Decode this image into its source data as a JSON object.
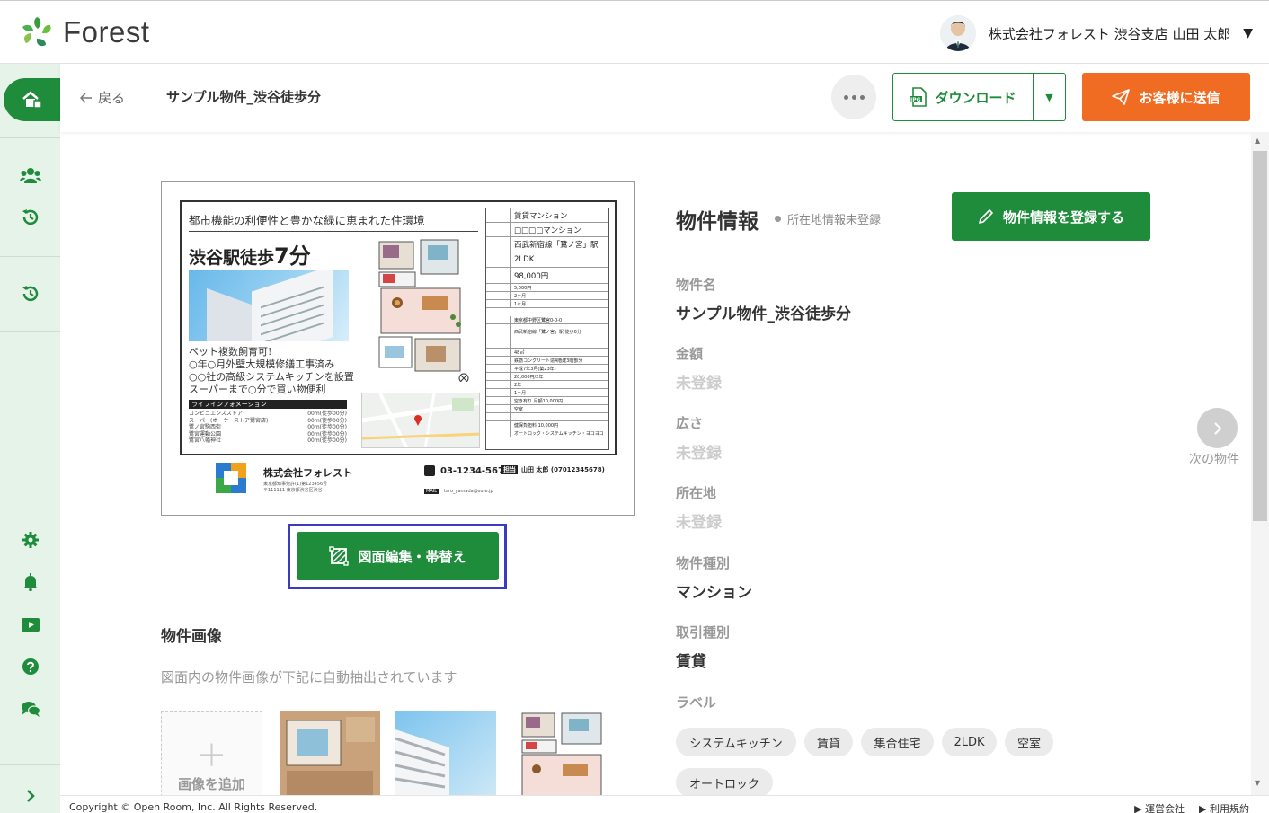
{
  "header": {
    "logo_text": "Forest",
    "user_name": "株式会社フォレスト 渋谷支店 山田 太郎",
    "user_menu_icon": "caret-down-icon"
  },
  "subbar": {
    "back_label": "戻る",
    "title": "サンプル物件_渋谷徒歩分",
    "download_label": "ダウンロード",
    "send_label": "お客様に送信"
  },
  "flyer": {
    "headline": "都市機能の利便性と豊かな緑に恵まれた住環境",
    "walk_prefix": "渋谷駅徒歩",
    "walk_minutes": "7分",
    "notes": [
      "ペット複数飼育可!",
      "○年○月外壁大規模修繕工事済み",
      "○○社の高級システムキッチンを設置",
      "スーパーまで○分で買い物便利"
    ],
    "info_heading": "ライフインフォメーション",
    "facilities": [
      {
        "name": "コンビニエンスストア",
        "dist": "00m(徒歩00分)"
      },
      {
        "name": "スーパー(オーケーストア鷺宮店)",
        "dist": "00m(徒歩00分)"
      },
      {
        "name": "鷺ノ宮駒西街",
        "dist": "00m(徒歩00分)"
      },
      {
        "name": "鷺宮運動公園",
        "dist": "00m(徒歩00分)"
      },
      {
        "name": "鷺宮八幡神社",
        "dist": "00m(徒歩00分)"
      }
    ],
    "table": [
      "賃貸マンション",
      "□□□□マンション",
      "西武新宿線「鷺ノ宮」駅",
      "2LDK",
      "98,000円",
      "5,000円",
      "2ヶ月",
      "1ヶ月"
    ],
    "table_small": [
      "東京都中野区鷺宮0-0-0",
      "西武新宿線「鷺ノ宮」駅 徒歩0分",
      "",
      "48㎡",
      "鉄筋コンクリート造4階建3階部分",
      "平成7年3月(築23年)",
      "20,000円/2年",
      "2年",
      "1ヶ月",
      "空き有り 月額10,000円",
      "空室",
      "",
      "健保負担料 10,000円",
      "オートロック・システムキッチン・ヨコヨコ"
    ],
    "company": "株式会社フォレスト",
    "company_addr": [
      "東京都知事免許(1)第123456号",
      "〒111111 東京都渋谷区渋谷"
    ],
    "tel": "03-1234-5678",
    "staff_tag": "担当",
    "staff": "山田 太郎 (07012345678)",
    "mail_tag": "MAIL",
    "mail": "taro_yamada@sute.jp"
  },
  "edit_button_label": "図面編集・帯替え",
  "images_section": {
    "title": "物件画像",
    "description": "図面内の物件画像が下記に自動抽出されています",
    "add_label": "画像を追加"
  },
  "info": {
    "title": "物件情報",
    "status": "所在地情報未登録",
    "register_label": "物件情報を登録する",
    "fields": [
      {
        "label": "物件名",
        "value": "サンプル物件_渋谷徒歩分"
      },
      {
        "label": "金額",
        "value": "未登録"
      },
      {
        "label": "広さ",
        "value": "未登録"
      },
      {
        "label": "所在地",
        "value": "未登録"
      },
      {
        "label": "物件種別",
        "value": "マンション"
      },
      {
        "label": "取引種別",
        "value": "賃貸"
      }
    ],
    "tags_label": "ラベル",
    "tags": [
      "システムキッチン",
      "賃貸",
      "集合住宅",
      "2LDK",
      "空室",
      "オートロック"
    ]
  },
  "next": {
    "label": "次の物件"
  },
  "footer": {
    "copyright": "Copyright © Open Room, Inc. All Rights Reserved.",
    "links": [
      "運営会社",
      "利用規約"
    ]
  },
  "colors": {
    "brand_green": "#1f8c3c",
    "accent_orange": "#ef6c22",
    "sidebar_bg": "#e6f3e9",
    "highlight": "#3b3bbf"
  }
}
